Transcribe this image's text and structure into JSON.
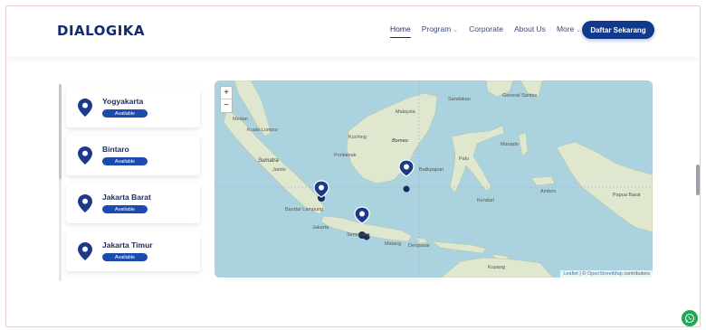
{
  "header": {
    "logo_text": "DIALOGIKA",
    "nav": [
      {
        "label": "Home",
        "active": true,
        "dropdown": false
      },
      {
        "label": "Program",
        "active": false,
        "dropdown": true
      },
      {
        "label": "Corporate",
        "active": false,
        "dropdown": false
      },
      {
        "label": "About Us",
        "active": false,
        "dropdown": false
      },
      {
        "label": "More",
        "active": false,
        "dropdown": true
      }
    ],
    "cta_label": "Daftar Sekarang"
  },
  "locations": [
    {
      "name": "Yogyakarta",
      "status": "Available"
    },
    {
      "name": "Bintaro",
      "status": "Available"
    },
    {
      "name": "Jakarta Barat",
      "status": "Available"
    },
    {
      "name": "Jakarta Timur",
      "status": "Available"
    }
  ],
  "map": {
    "zoom_in": "+",
    "zoom_out": "−",
    "attribution_leaflet": "Leaflet",
    "attribution_sep": " | © ",
    "attribution_osm": "OpenStreetMap",
    "attribution_tail": " contributors",
    "labels": {
      "sumatra": "Sumatra",
      "jakarta": "Jakarta",
      "semarang": "Semarang",
      "malaysia": "Malaysia",
      "borneo": "Borneo",
      "pontianak": "Pontianak",
      "balikpapan": "Balikpapan",
      "kuching": "Kuching",
      "bandar_lampung": "Bandar Lampung",
      "palu": "Palu",
      "ambon": "Ambon",
      "manado": "Manado",
      "kendari": "Kendari",
      "malang": "Malang",
      "denpasar": "Denpasar",
      "kupang": "Kupang",
      "medan": "Medan",
      "kuala_lumpur": "Kuala Lumpur",
      "jambi": "Jambi",
      "sandakan": "Sandakan",
      "general_santos": "General Santos",
      "papua_barat": "Papua Barat"
    }
  },
  "colors": {
    "brand_navy": "#132a6b",
    "cta": "#123a8c",
    "badge": "#1b4bb0",
    "whatsapp": "#1fa756",
    "sea": "#aad3df",
    "land": "#dfe8cf"
  }
}
